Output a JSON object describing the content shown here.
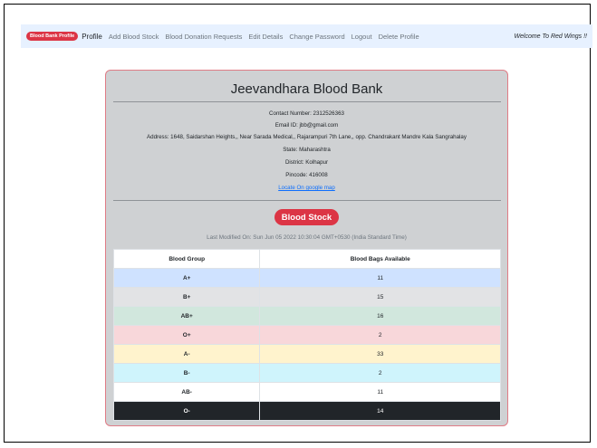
{
  "nav": {
    "brand_label": "Blood Bank Profile",
    "items": [
      "Profile",
      "Add Blood Stock",
      "Blood Donation Requests",
      "Edit Details",
      "Change Password",
      "Logout",
      "Delete Profile"
    ],
    "welcome": "Welcome To Red Wings !!"
  },
  "bank": {
    "name": "Jeevandhara Blood Bank",
    "contact": "Contact Number: 2312526363",
    "email": "Email ID: jbb@gmail.com",
    "address": "Address: 1648, Saidarshan Heights,, Near Sarada Medical,, Rajarampuri 7th Lane,, opp. Chandrakant Mandre Kala Sangrahalay",
    "state": "State: Maharashtra",
    "district": "District: Kolhapur",
    "pincode": "Pincode: 416008",
    "map_link": "Locate On google map"
  },
  "stock": {
    "heading": "Blood Stock",
    "last_modified": "Last Modified On: Sun Jun 05 2022 10:30:04 GMT+0530 (India Standard Time)",
    "columns": [
      "Blood Group",
      "Blood Bags Available"
    ],
    "rows": [
      {
        "group": "A+",
        "bags": "11",
        "color": "#cfe2ff"
      },
      {
        "group": "B+",
        "bags": "15",
        "color": "#e2e3e5"
      },
      {
        "group": "AB+",
        "bags": "16",
        "color": "#d1e7dd"
      },
      {
        "group": "O+",
        "bags": "2",
        "color": "#f8d7da"
      },
      {
        "group": "A-",
        "bags": "33",
        "color": "#fff3cd"
      },
      {
        "group": "B-",
        "bags": "2",
        "color": "#cff4fc"
      },
      {
        "group": "AB-",
        "bags": "11",
        "color": "#ffffff"
      },
      {
        "group": "O-",
        "bags": "14",
        "color": "#212529"
      }
    ]
  },
  "colors": {
    "accent": "#dc3545",
    "navbar_bg": "#e7f1ff",
    "card_bg": "#cfd1d3",
    "link": "#0d6efd"
  }
}
